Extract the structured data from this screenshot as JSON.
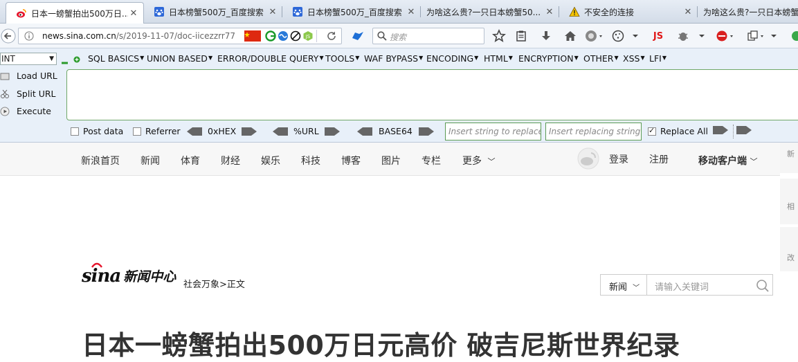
{
  "tabs": [
    {
      "title": "日本一螃蟹拍出500万日...",
      "icon": "weibo-icon",
      "active": true
    },
    {
      "title": "日本榜蟹500万_百度搜索",
      "icon": "baidu-icon",
      "active": false
    },
    {
      "title": "日本榜蟹500万_百度搜索",
      "icon": "baidu-icon",
      "active": false
    },
    {
      "title": "为啥这么贵?一只日本螃蟹50...",
      "icon": "none",
      "active": false
    },
    {
      "title": "不安全的连接",
      "icon": "warning-icon",
      "active": false
    },
    {
      "title": "为啥这么贵?一只日本螃蟹",
      "icon": "none",
      "active": false
    }
  ],
  "navbar": {
    "url_host": "news.sina.com.cn",
    "url_path": "/s/2019-11-07/doc-iicezzrr77",
    "search_placeholder": "搜索",
    "js_label": "JS"
  },
  "hackbar": {
    "select_value": "INT",
    "menu": [
      "SQL BASICS",
      "UNION BASED",
      "ERROR/DOUBLE QUERY",
      "TOOLS",
      "WAF BYPASS",
      "ENCODING",
      "HTML",
      "ENCRYPTION",
      "OTHER",
      "XSS",
      "LFI"
    ],
    "load_url": "Load URL",
    "split_url": "Split URL",
    "execute": "Execute",
    "post_data": "Post data",
    "referrer": "Referrer",
    "hex": "0xHEX",
    "url": "%URL",
    "base64": "BASE64",
    "insert_string_placeholder": "Insert string to replace",
    "insert_replacing_placeholder": "Insert replacing string",
    "replace_all": "Replace All"
  },
  "sina_nav": {
    "items": [
      "新浪首页",
      "新闻",
      "体育",
      "财经",
      "娱乐",
      "科技",
      "博客",
      "图片",
      "专栏"
    ],
    "more": "更多",
    "login": "登录",
    "register": "注册",
    "mobile": "移动客户端"
  },
  "rail": [
    "新",
    "相",
    "改"
  ],
  "logo": {
    "wordmark": "sina",
    "name": "新闻中心"
  },
  "breadcrumb": {
    "section": "社会万象",
    "sep": ">",
    "current": "正文"
  },
  "site_search": {
    "category": "新闻",
    "placeholder": "请输入关键词"
  },
  "headline": "日本一螃蟹拍出500万日元高价 破吉尼斯世界纪录"
}
